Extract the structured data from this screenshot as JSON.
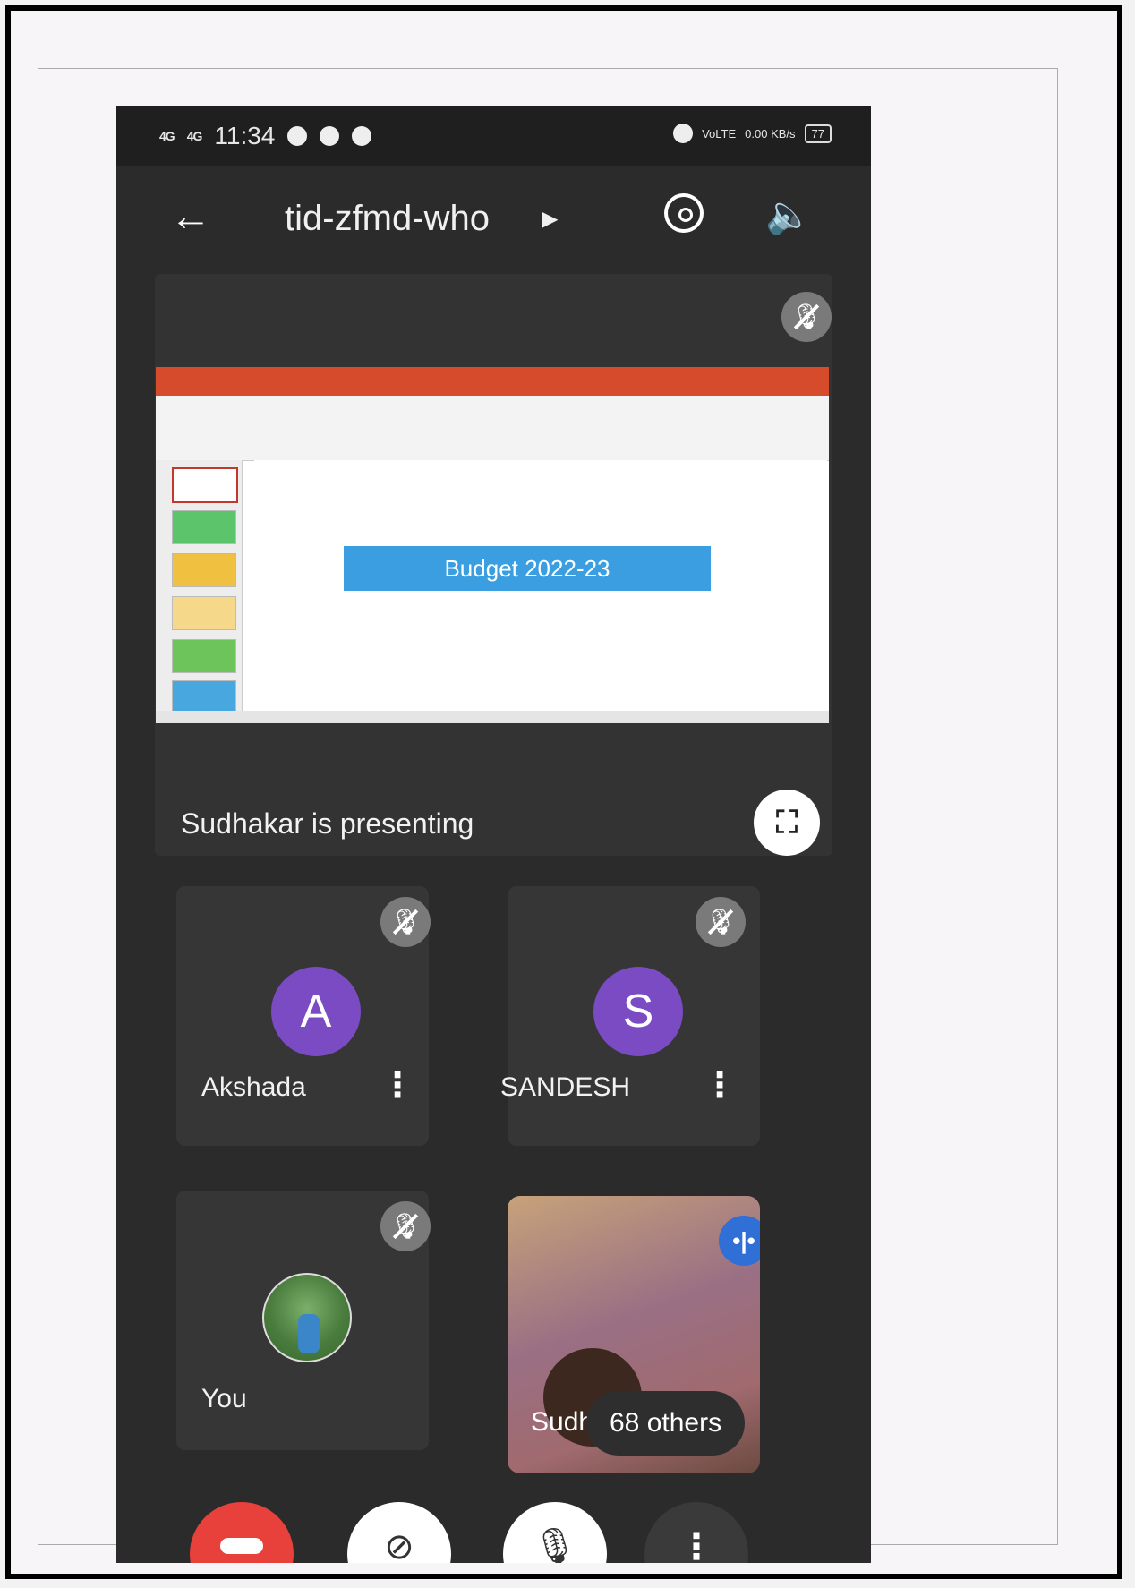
{
  "status_bar": {
    "signal1": "4G",
    "signal2": "4G",
    "time": "11:34",
    "volte": "VoLTE",
    "speed": "0.00 KB/s",
    "battery": "77"
  },
  "header": {
    "meeting_code": "tid-zfmd-who"
  },
  "presentation": {
    "slide_title": "Budget 2022-23",
    "presenter_text": "Sudhakar is presenting"
  },
  "participants": [
    {
      "initial": "A",
      "name": "Akshada",
      "avatar_color": "#7b4bc4"
    },
    {
      "initial": "S",
      "name": "SANDESH",
      "avatar_color": "#7b4bc4"
    },
    {
      "name": "You"
    },
    {
      "name": "Sudh",
      "others": "68 others"
    }
  ],
  "icons": {
    "back": "arrow-left-icon",
    "rotate_camera": "camera-switch-icon",
    "speaker": "speaker-icon",
    "mic_off": "mic-off-icon",
    "fullscreen": "fullscreen-icon",
    "more": "more-vertical-icon",
    "talking": "audio-level-icon",
    "end_call": "end-call-icon",
    "camera_off": "camera-off-icon"
  },
  "colors": {
    "end_call": "#e8403a",
    "avatar": "#7b4bc4",
    "talk_badge": "#2f6fd6",
    "slide_banner": "#3a9ee0"
  }
}
